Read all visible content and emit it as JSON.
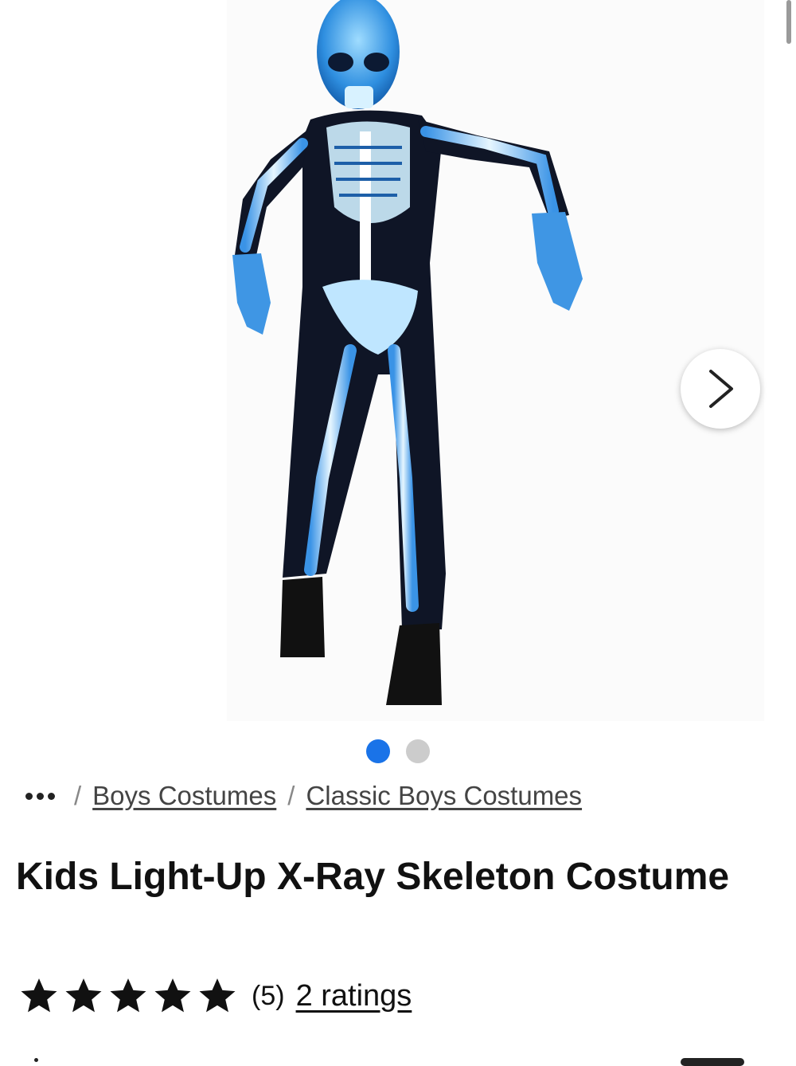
{
  "product": {
    "title": "Kids Light-Up X-Ray Skeleton Costume",
    "image_alt": "X-ray skeleton costume",
    "rating_count_display": "(5)",
    "ratings_link": "2 ratings",
    "stars_filled": 5,
    "stars_total": 5
  },
  "gallery": {
    "total_images": 2,
    "active_index": 0,
    "next_icon": "chevron-right-icon",
    "colors": {
      "active_dot": "#1a73e8",
      "inactive_dot": "#cccccc"
    }
  },
  "breadcrumb": {
    "more_icon": "ellipsis-icon",
    "separator": "/",
    "items": [
      "Boys Costumes",
      "Classic Boys Costumes"
    ]
  }
}
